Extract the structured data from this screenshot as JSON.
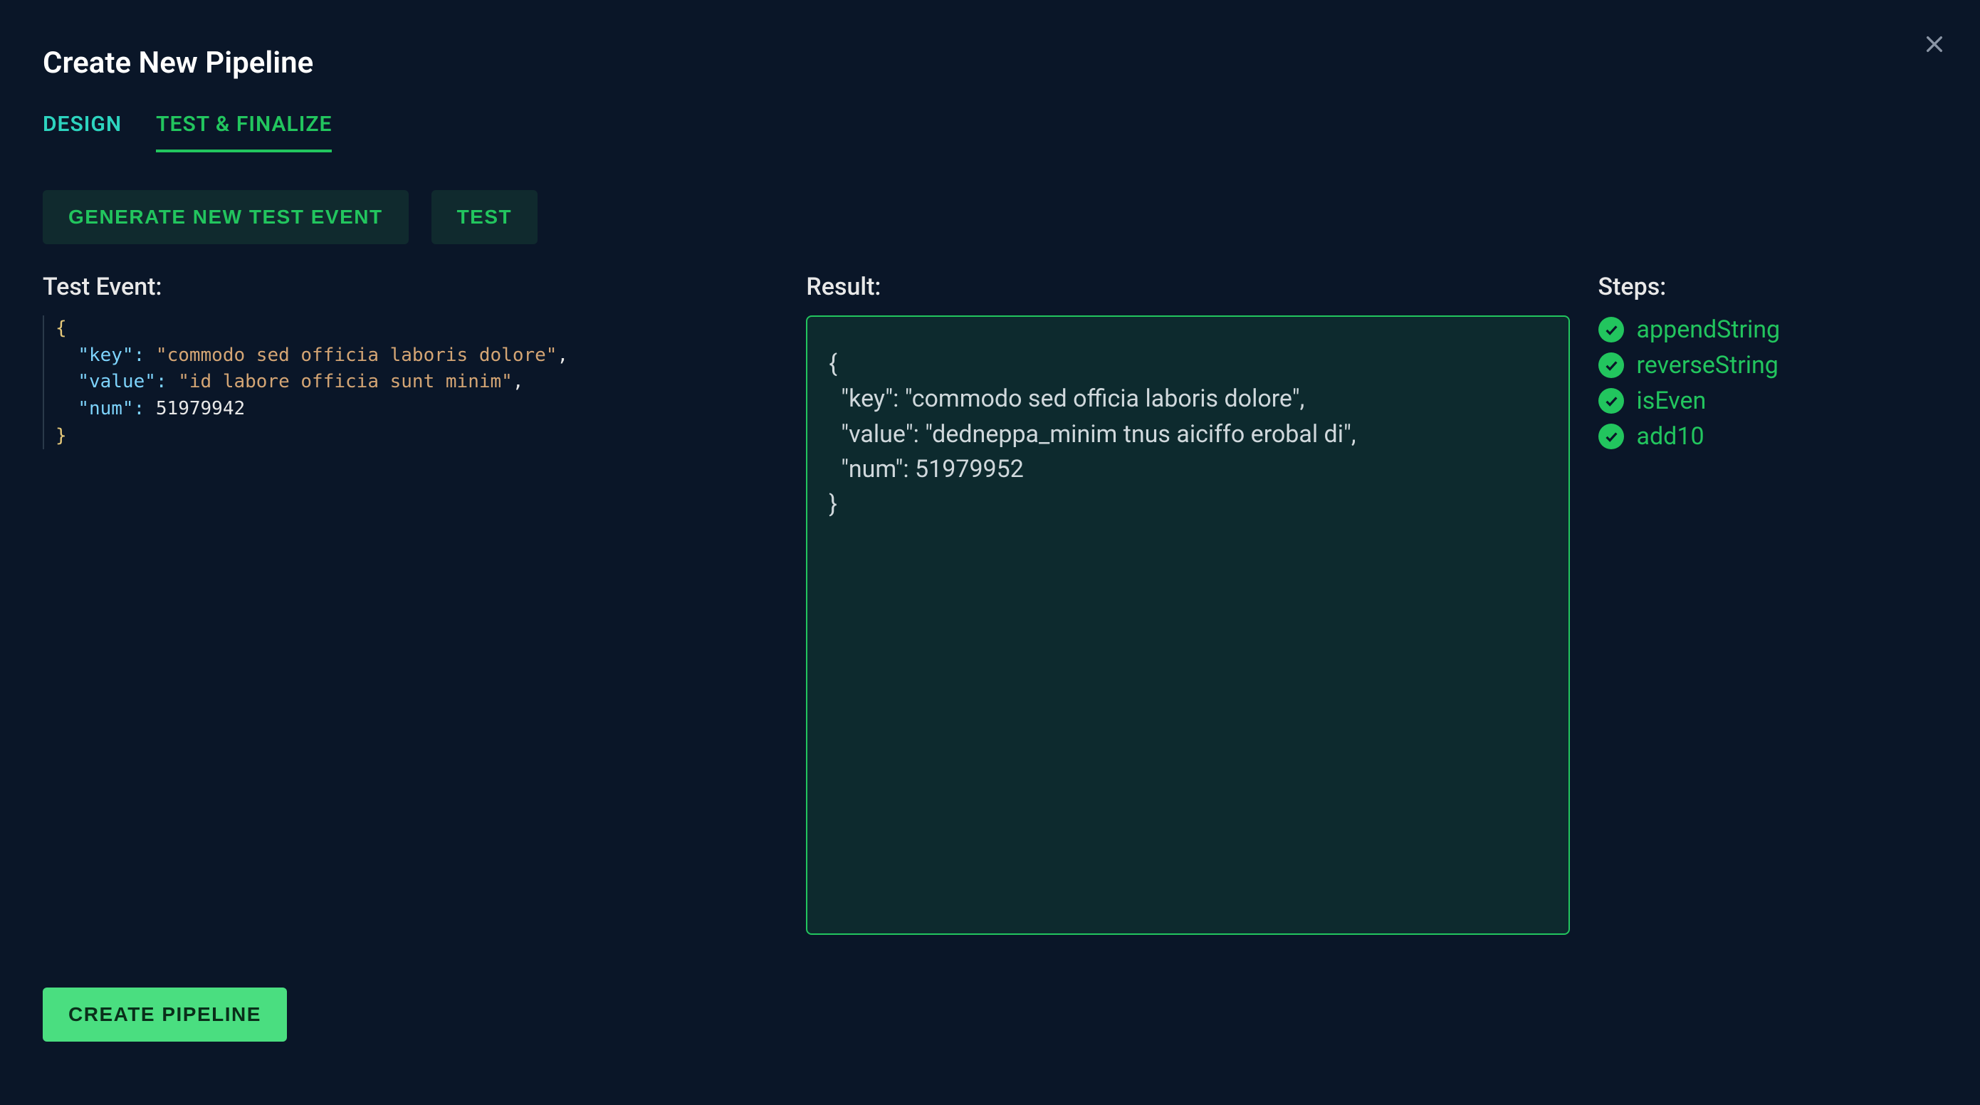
{
  "header": {
    "title": "Create New Pipeline"
  },
  "tabs": [
    {
      "label": "DESIGN",
      "active": false
    },
    {
      "label": "TEST & FINALIZE",
      "active": true
    }
  ],
  "actions": {
    "generate_label": "GENERATE NEW TEST EVENT",
    "test_label": "TEST",
    "create_label": "CREATE PIPELINE"
  },
  "labels": {
    "test_event": "Test Event:",
    "result": "Result:",
    "steps": "Steps:"
  },
  "test_event": {
    "key": "commodo sed officia laboris dolore",
    "value": "id labore officia sunt minim",
    "num": 51979942
  },
  "result_text": "{\n  \"key\": \"commodo sed officia laboris dolore\",\n  \"value\": \"dedneppa_minim tnus aiciffo erobal di\",\n  \"num\": 51979952\n}",
  "steps": [
    {
      "name": "appendString",
      "ok": true
    },
    {
      "name": "reverseString",
      "ok": true
    },
    {
      "name": "isEven",
      "ok": true
    },
    {
      "name": "add10",
      "ok": true
    }
  ]
}
